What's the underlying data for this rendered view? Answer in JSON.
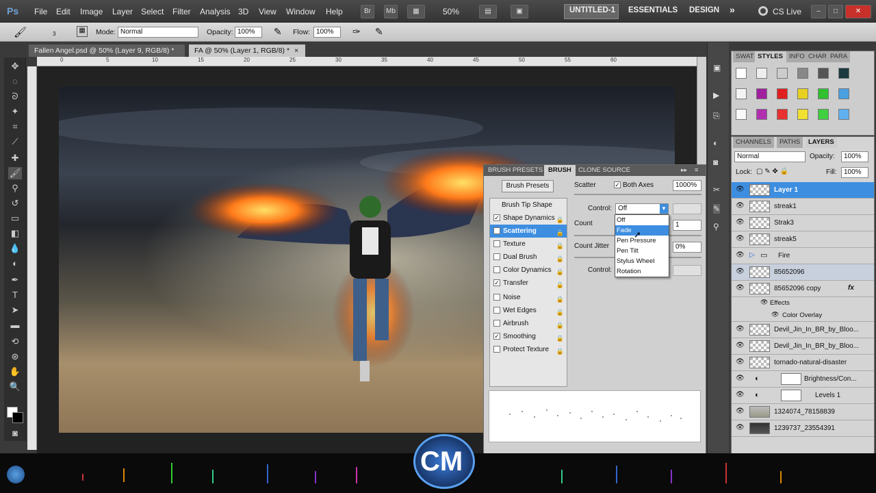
{
  "app": {
    "logo": "Ps"
  },
  "menu": {
    "items": [
      "File",
      "Edit",
      "Image",
      "Layer",
      "Select",
      "Filter",
      "Analysis",
      "3D",
      "View",
      "Window",
      "Help"
    ]
  },
  "menubar_buttons": {
    "bridge": "Br",
    "mini": "Mb",
    "zoom": "50%"
  },
  "workspaces": {
    "current": "UNTITLED-1",
    "essentials": "ESSENTIALS",
    "design": "DESIGN",
    "more": "»",
    "cslive": "CS Live"
  },
  "options": {
    "brush_size": "3",
    "mode_label": "Mode:",
    "mode_value": "Normal",
    "opacity_label": "Opacity:",
    "opacity_value": "100%",
    "flow_label": "Flow:",
    "flow_value": "100%"
  },
  "document_tabs": [
    {
      "label": "Fallen Angel.psd @ 50% (Layer 9, RGB/8) *",
      "close": "×"
    },
    {
      "label": "FA @ 50% (Layer 1, RGB/8) *",
      "close": "×"
    }
  ],
  "ruler_ticks": [
    "0",
    "5",
    "10",
    "15",
    "20",
    "25",
    "30",
    "35",
    "40",
    "45",
    "50",
    "55",
    "60"
  ],
  "swatch_panel": {
    "tabs": [
      "SWAT",
      "STYLES",
      "INFO",
      "CHAR",
      "PARA"
    ],
    "active": "STYLES"
  },
  "layers_panel": {
    "tabs": [
      "CHANNELS",
      "PATHS",
      "LAYERS"
    ],
    "blend_mode": "Normal",
    "opacity_label": "Opacity:",
    "opacity_value": "100%",
    "lock_label": "Lock:",
    "fill_label": "Fill:",
    "fill_value": "100%",
    "layers": [
      {
        "name": "Layer 1",
        "selected": true
      },
      {
        "name": "streak1"
      },
      {
        "name": "Strak3"
      },
      {
        "name": "streak5"
      },
      {
        "name": "Fire",
        "group": true
      },
      {
        "name": "85652096"
      },
      {
        "name": "85652096 copy",
        "fx": "fx"
      },
      {
        "name": "Effects",
        "sub": true
      },
      {
        "name": "Color Overlay",
        "sub2": true
      },
      {
        "name": "Devil_Jin_In_BR_by_Bloo..."
      },
      {
        "name": "Devil_Jin_In_BR_by_Bloo..."
      },
      {
        "name": "tornado-natural-disaster"
      },
      {
        "name": "Brightness/Con...",
        "adjust": true
      },
      {
        "name": "Levels 1",
        "adjust": true
      },
      {
        "name": "1324074_78158839"
      },
      {
        "name": "1239737_23554391"
      }
    ]
  },
  "brush_panel": {
    "tabs": [
      "BRUSH PRESETS",
      "BRUSH",
      "CLONE SOURCE"
    ],
    "active_tab": "BRUSH",
    "presets_button": "Brush Presets",
    "scatter_label": "Scatter",
    "both_axes_label": "Both Axes",
    "scatter_value": "1000%",
    "control_label": "Control:",
    "control_value": "Off",
    "count_label": "Count",
    "count_value": "1",
    "count_jitter_label": "Count Jitter",
    "count_jitter_value": "0%",
    "control2_label": "Control:",
    "list": [
      {
        "label": "Brush Tip Shape",
        "checkbox": false,
        "checked": false
      },
      {
        "label": "Shape Dynamics",
        "checkbox": true,
        "checked": true
      },
      {
        "label": "Scattering",
        "checkbox": true,
        "checked": true,
        "selected": true
      },
      {
        "label": "Texture",
        "checkbox": true,
        "checked": false
      },
      {
        "label": "Dual Brush",
        "checkbox": true,
        "checked": false
      },
      {
        "label": "Color Dynamics",
        "checkbox": true,
        "checked": false
      },
      {
        "label": "Transfer",
        "checkbox": true,
        "checked": true
      },
      {
        "label": "Noise",
        "checkbox": true,
        "checked": false
      },
      {
        "label": "Wet Edges",
        "checkbox": true,
        "checked": false
      },
      {
        "label": "Airbrush",
        "checkbox": true,
        "checked": false
      },
      {
        "label": "Smoothing",
        "checkbox": true,
        "checked": true
      },
      {
        "label": "Protect Texture",
        "checkbox": true,
        "checked": false
      }
    ],
    "dropdown_options": [
      "Off",
      "Fade",
      "Pen Pressure",
      "Pen Tilt",
      "Stylus Wheel",
      "Rotation"
    ],
    "dropdown_highlighted": "Fade"
  },
  "watermark": {
    "text": "CM"
  },
  "colors": {
    "accent": "#3d8ee0",
    "ui_dark": "#3a3a3a",
    "panel": "#d4d4d4"
  }
}
